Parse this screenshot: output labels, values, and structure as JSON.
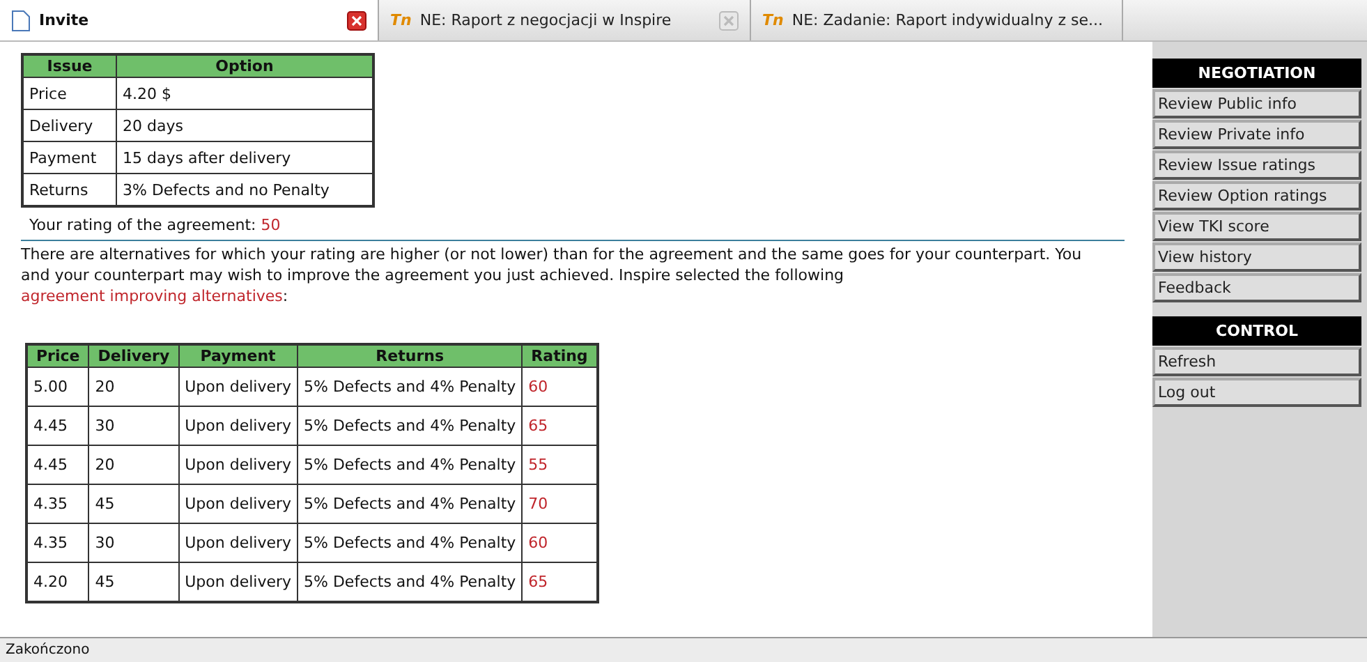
{
  "tabs": [
    {
      "label": "Invite",
      "selected": true,
      "kind": "page"
    },
    {
      "label": "NE: Raport z negocjacji w Inspire",
      "selected": false,
      "kind": "logo",
      "logo": "Tn"
    },
    {
      "label": "NE: Zadanie: Raport indywidualny z se...",
      "selected": false,
      "kind": "logo",
      "logo": "Tn"
    }
  ],
  "agreement_table": {
    "columns": [
      "Issue",
      "Option"
    ],
    "rows": [
      [
        "Price",
        "4.20 $"
      ],
      [
        "Delivery",
        "20 days"
      ],
      [
        "Payment",
        "15 days after delivery"
      ],
      [
        "Returns",
        "3% Defects and no Penalty"
      ]
    ]
  },
  "rating": {
    "label": "Your rating of the agreement:",
    "value": "50"
  },
  "message": "There are alternatives for which your rating are higher (or not lower) than for the agreement and the same goes for your counterpart. You and your counterpart may wish to improve the agreement you just achieved. Inspire selected the following",
  "message_link": "agreement improving alternatives",
  "message_end": ":",
  "alternatives_table": {
    "columns": [
      "Price",
      "Delivery",
      "Payment",
      "Returns",
      "Rating"
    ],
    "rows": [
      [
        "5.00",
        "20",
        "Upon delivery",
        "5% Defects and 4% Penalty",
        "60"
      ],
      [
        "4.45",
        "30",
        "Upon delivery",
        "5% Defects and 4% Penalty",
        "65"
      ],
      [
        "4.45",
        "20",
        "Upon delivery",
        "5% Defects and 4% Penalty",
        "55"
      ],
      [
        "4.35",
        "45",
        "Upon delivery",
        "5% Defects and 4% Penalty",
        "70"
      ],
      [
        "4.35",
        "30",
        "Upon delivery",
        "5% Defects and 4% Penalty",
        "60"
      ],
      [
        "4.20",
        "45",
        "Upon delivery",
        "5% Defects and 4% Penalty",
        "65"
      ]
    ]
  },
  "sidebar": {
    "sections": [
      {
        "title": "NEGOTIATION",
        "items": [
          "Review Public info",
          "Review Private info",
          "Review Issue ratings",
          "Review Option ratings",
          "View TKI score",
          "View history",
          "Feedback"
        ]
      },
      {
        "title": "CONTROL",
        "items": [
          "Refresh",
          "Log out"
        ]
      }
    ]
  },
  "status_bar": "Zakończono"
}
